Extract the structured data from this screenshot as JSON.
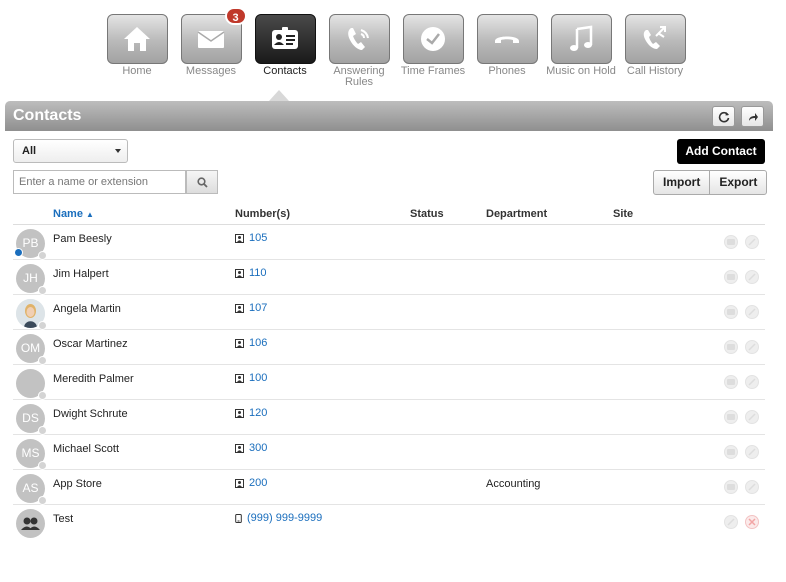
{
  "nav": {
    "items": [
      {
        "label": "Home",
        "icon": "home-icon"
      },
      {
        "label": "Messages",
        "icon": "envelope-icon",
        "badge": "3"
      },
      {
        "label": "Contacts",
        "icon": "contact-card-icon",
        "active": true
      },
      {
        "label": "Answering Rules",
        "icon": "phone-rules-icon"
      },
      {
        "label": "Time Frames",
        "icon": "clock-icon"
      },
      {
        "label": "Phones",
        "icon": "handset-icon"
      },
      {
        "label": "Music on Hold",
        "icon": "music-note-icon"
      },
      {
        "label": "Call History",
        "icon": "call-history-icon"
      }
    ]
  },
  "header": {
    "title": "Contacts"
  },
  "filter": {
    "selected": "All"
  },
  "search": {
    "placeholder": "Enter a name or extension"
  },
  "buttons": {
    "add": "Add Contact",
    "import": "Import",
    "export": "Export"
  },
  "table": {
    "columns": {
      "name": "Name",
      "numbers": "Number(s)",
      "status": "Status",
      "department": "Department",
      "site": "Site"
    },
    "rows": [
      {
        "initials": "PB",
        "name": "Pam Beesly",
        "number": "105",
        "department": "",
        "presence_blue": true
      },
      {
        "initials": "JH",
        "name": "Jim Halpert",
        "number": "110",
        "department": ""
      },
      {
        "initials": "",
        "name": "Angela Martin",
        "number": "107",
        "department": "",
        "photo": true
      },
      {
        "initials": "OM",
        "name": "Oscar Martinez",
        "number": "106",
        "department": ""
      },
      {
        "initials": "",
        "name": "Meredith Palmer",
        "number": "100",
        "department": ""
      },
      {
        "initials": "DS",
        "name": "Dwight Schrute",
        "number": "120",
        "department": ""
      },
      {
        "initials": "MS",
        "name": "Michael Scott",
        "number": "300",
        "department": ""
      },
      {
        "initials": "AS",
        "name": "App Store",
        "number": "200",
        "department": "Accounting"
      },
      {
        "initials": "",
        "name": "Test",
        "number": "(999) 999-9999",
        "department": "",
        "group": true,
        "mobile": true
      }
    ]
  },
  "colors": {
    "accent": "#1a6ebd",
    "badge": "#c0392b",
    "presence": "#1a6ebd"
  }
}
